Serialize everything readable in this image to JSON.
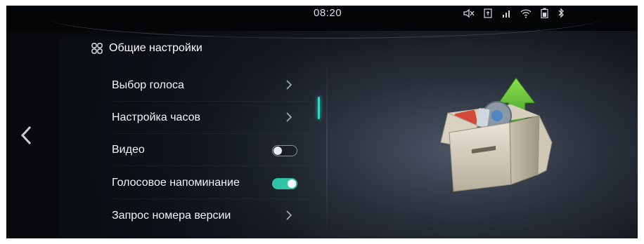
{
  "status_bar": {
    "time": "08:20",
    "icons": [
      "volume-muted-icon",
      "sim-card-icon",
      "signal-icon",
      "wifi-icon",
      "battery-icon",
      "bluetooth-icon"
    ]
  },
  "nav": {
    "back_icon": "chevron-left-icon"
  },
  "settings": {
    "title": "Общие настройки",
    "title_icon": "grid-icon",
    "items": [
      {
        "label": "Выбор голоса",
        "control": "chevron"
      },
      {
        "label": "Настройка часов",
        "control": "chevron"
      },
      {
        "label": "Видео",
        "control": "toggle",
        "state": "off"
      },
      {
        "label": "Голосовое напоминание",
        "control": "toggle",
        "state": "on"
      },
      {
        "label": "Запрос номера версии",
        "control": "chevron"
      }
    ]
  },
  "colors": {
    "accent": "#32c3a7",
    "text": "#f2f4f7",
    "background": "#13171e"
  },
  "illustration": {
    "icon": "software-update-box-icon"
  }
}
